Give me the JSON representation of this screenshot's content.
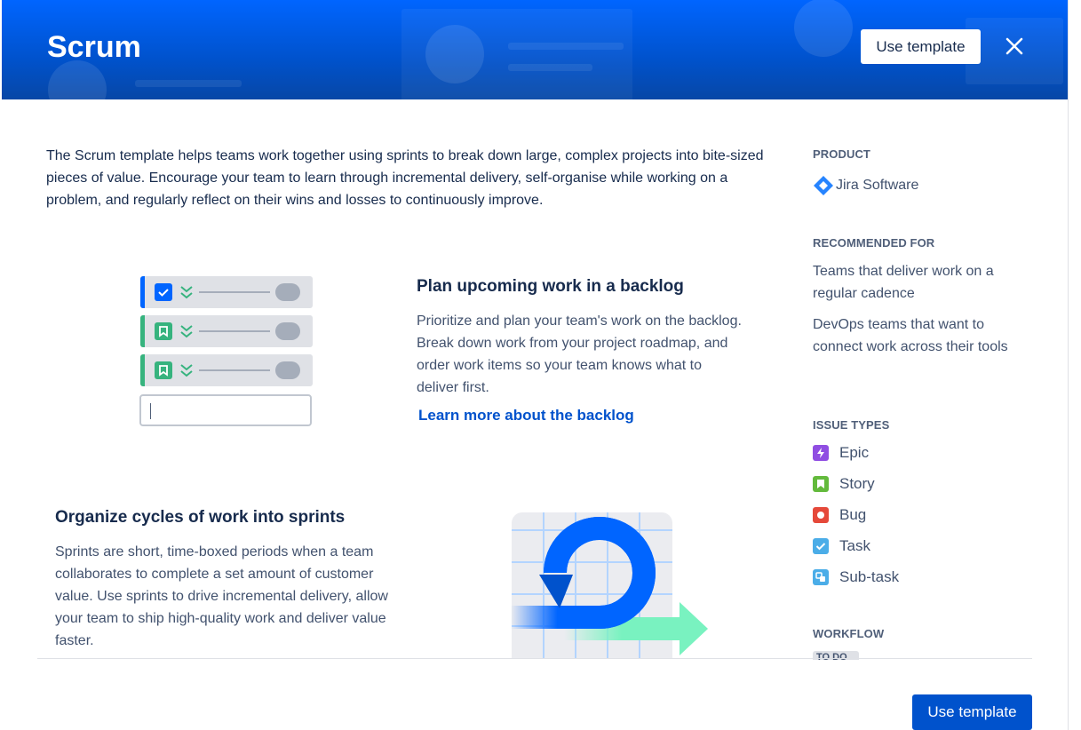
{
  "header": {
    "title": "Scrum",
    "use_template_label": "Use template",
    "close_icon": "close-icon"
  },
  "description": "The Scrum template helps teams work together using sprints to break down large, complex projects into bite-sized pieces of value. Encourage your team to learn through incremental delivery, self-organise while working on a problem, and regularly reflect on their wins and losses to continuously improve.",
  "sections": [
    {
      "heading": "Plan upcoming work in a backlog",
      "body": "Prioritize and plan your team's work on the backlog. Break down work from your project roadmap, and order work items so your team knows what to deliver first.",
      "link": "Learn more about the backlog"
    },
    {
      "heading": "Organize cycles of work into sprints",
      "body": "Sprints are short, time-boxed periods when a team collaborates to complete a set amount of customer value. Use sprints to drive incremental delivery, allow your team to ship high-quality work and deliver value faster."
    }
  ],
  "sidebar": {
    "product_label": "PRODUCT",
    "product_name": "Jira Software",
    "recommended_label": "RECOMMENDED FOR",
    "recommended": [
      "Teams that deliver work on a regular cadence",
      "DevOps teams that want to connect work across their tools"
    ],
    "issue_types_label": "ISSUE TYPES",
    "issue_types": [
      {
        "name": "Epic",
        "icon": "epic-icon",
        "color": "#904ee2"
      },
      {
        "name": "Story",
        "icon": "story-icon",
        "color": "#63ba3c"
      },
      {
        "name": "Bug",
        "icon": "bug-icon",
        "color": "#e5493a"
      },
      {
        "name": "Task",
        "icon": "task-icon",
        "color": "#4bade8"
      },
      {
        "name": "Sub-task",
        "icon": "subtask-icon",
        "color": "#4bade8"
      }
    ],
    "workflow_label": "WORKFLOW",
    "workflow_first_status": "TO DO"
  },
  "footer": {
    "use_template_label": "Use template"
  },
  "colors": {
    "brand_blue": "#0052cc",
    "header_gradient_top": "#0065ff",
    "text": "#172b4d",
    "subtle_text": "#42526e"
  }
}
